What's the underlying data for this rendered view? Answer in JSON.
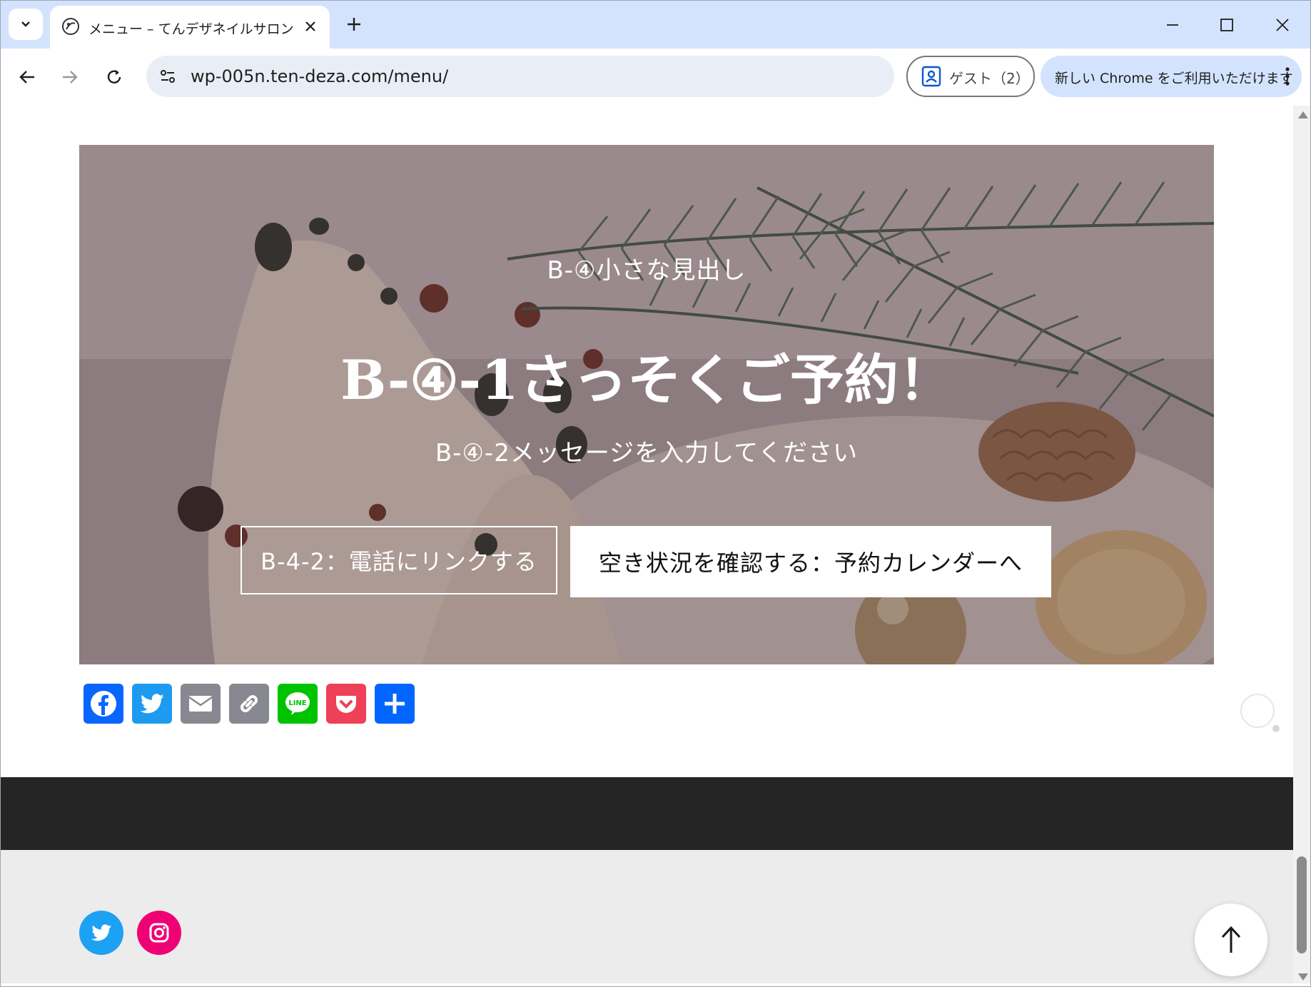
{
  "browser": {
    "tab_title": "メニュー – てんデザネイルサロン",
    "url": "wp-005n.ten-deza.com/menu/",
    "profile_label": "ゲスト（2）",
    "update_label": "新しい Chrome をご利用いただけます",
    "icons": [
      "tab-search-icon",
      "close-icon",
      "new-tab-icon",
      "minimize-icon",
      "maximize-icon",
      "back-icon",
      "forward-icon",
      "reload-icon",
      "site-info-icon",
      "profile-icon",
      "menu-dots-icon"
    ]
  },
  "hero": {
    "small_heading": "B-④小さな見出し",
    "title": "B-④-1さっそくご予約！",
    "message": "B-④-2メッセージを入力してください",
    "phone_button": "B-4-2：電話にリンクする",
    "calendar_button": "空き状況を確認する：予約カレンダーへ"
  },
  "share": {
    "buttons": [
      {
        "name": "Facebook",
        "color": "#0866ff"
      },
      {
        "name": "Twitter",
        "color": "#1d9bf0"
      },
      {
        "name": "Email",
        "color": "#888990"
      },
      {
        "name": "Copy Link",
        "color": "#888990"
      },
      {
        "name": "Line",
        "color": "#00c300"
      },
      {
        "name": "Pocket",
        "color": "#ee4056"
      },
      {
        "name": "Share",
        "color": "#0166ff"
      }
    ]
  },
  "footer": {
    "social": [
      {
        "name": "twitter",
        "color": "#1da1f2"
      },
      {
        "name": "instagram",
        "color": "#f00075"
      }
    ]
  },
  "colors": {
    "tabstrip": "#d3e3fd",
    "footer_dark": "#252525",
    "footer_light": "#ececec"
  }
}
